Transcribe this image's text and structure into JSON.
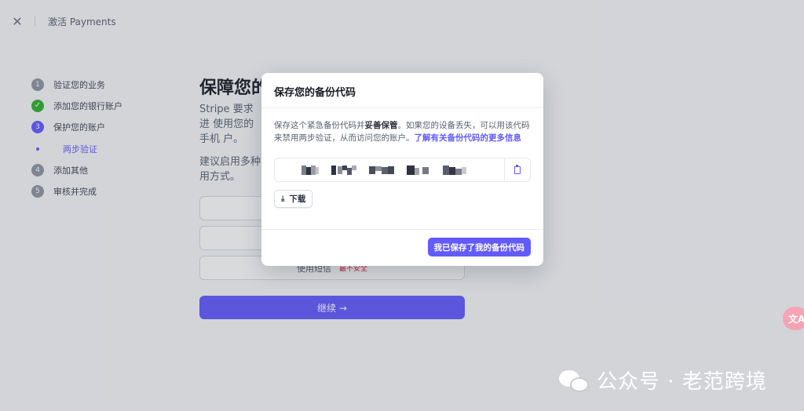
{
  "topbar": {
    "close_icon": "close-icon",
    "title": "激活 Payments"
  },
  "steps": [
    {
      "num": "1",
      "label": "验证您的业务",
      "state": "pending"
    },
    {
      "num": "✓",
      "label": "添加您的银行账户",
      "state": "done"
    },
    {
      "num": "3",
      "label": "保护您的账户",
      "state": "active"
    },
    {
      "label": "两步验证",
      "state": "sub"
    },
    {
      "num": "4",
      "label": "添加其他",
      "state": "pending"
    },
    {
      "num": "5",
      "label": "审核并完成",
      "state": "pending"
    }
  ],
  "main": {
    "heading": "保障您的",
    "desc": "Stripe 要求进 使用您的手机 户。",
    "desc2": "建议启用多种 用方式。",
    "sms_option": "使用短信",
    "sms_warning": "最不安全",
    "continue": "继续 →"
  },
  "modal": {
    "title": "保存您的备份代码",
    "info_before": "保存这个紧急备份代码并",
    "info_bold": "妥善保管",
    "info_after": "。如果您的设备丢失，可以用该代码来禁用两步验证，从而访问您的账户。",
    "info_link": "了解有关备份代码的更多信息",
    "codes_hidden": true,
    "copy_icon": "clipboard-icon",
    "download_icon": "download-icon",
    "download_label": "下载",
    "confirm_label": "我已保存了我的备份代码"
  },
  "translate_icon": "translate-icon",
  "translate_label": "文A",
  "watermark": "公众号 · 老范跨境",
  "colors": {
    "accent": "#635bff",
    "success": "#30b130",
    "danger": "#df1b41"
  }
}
